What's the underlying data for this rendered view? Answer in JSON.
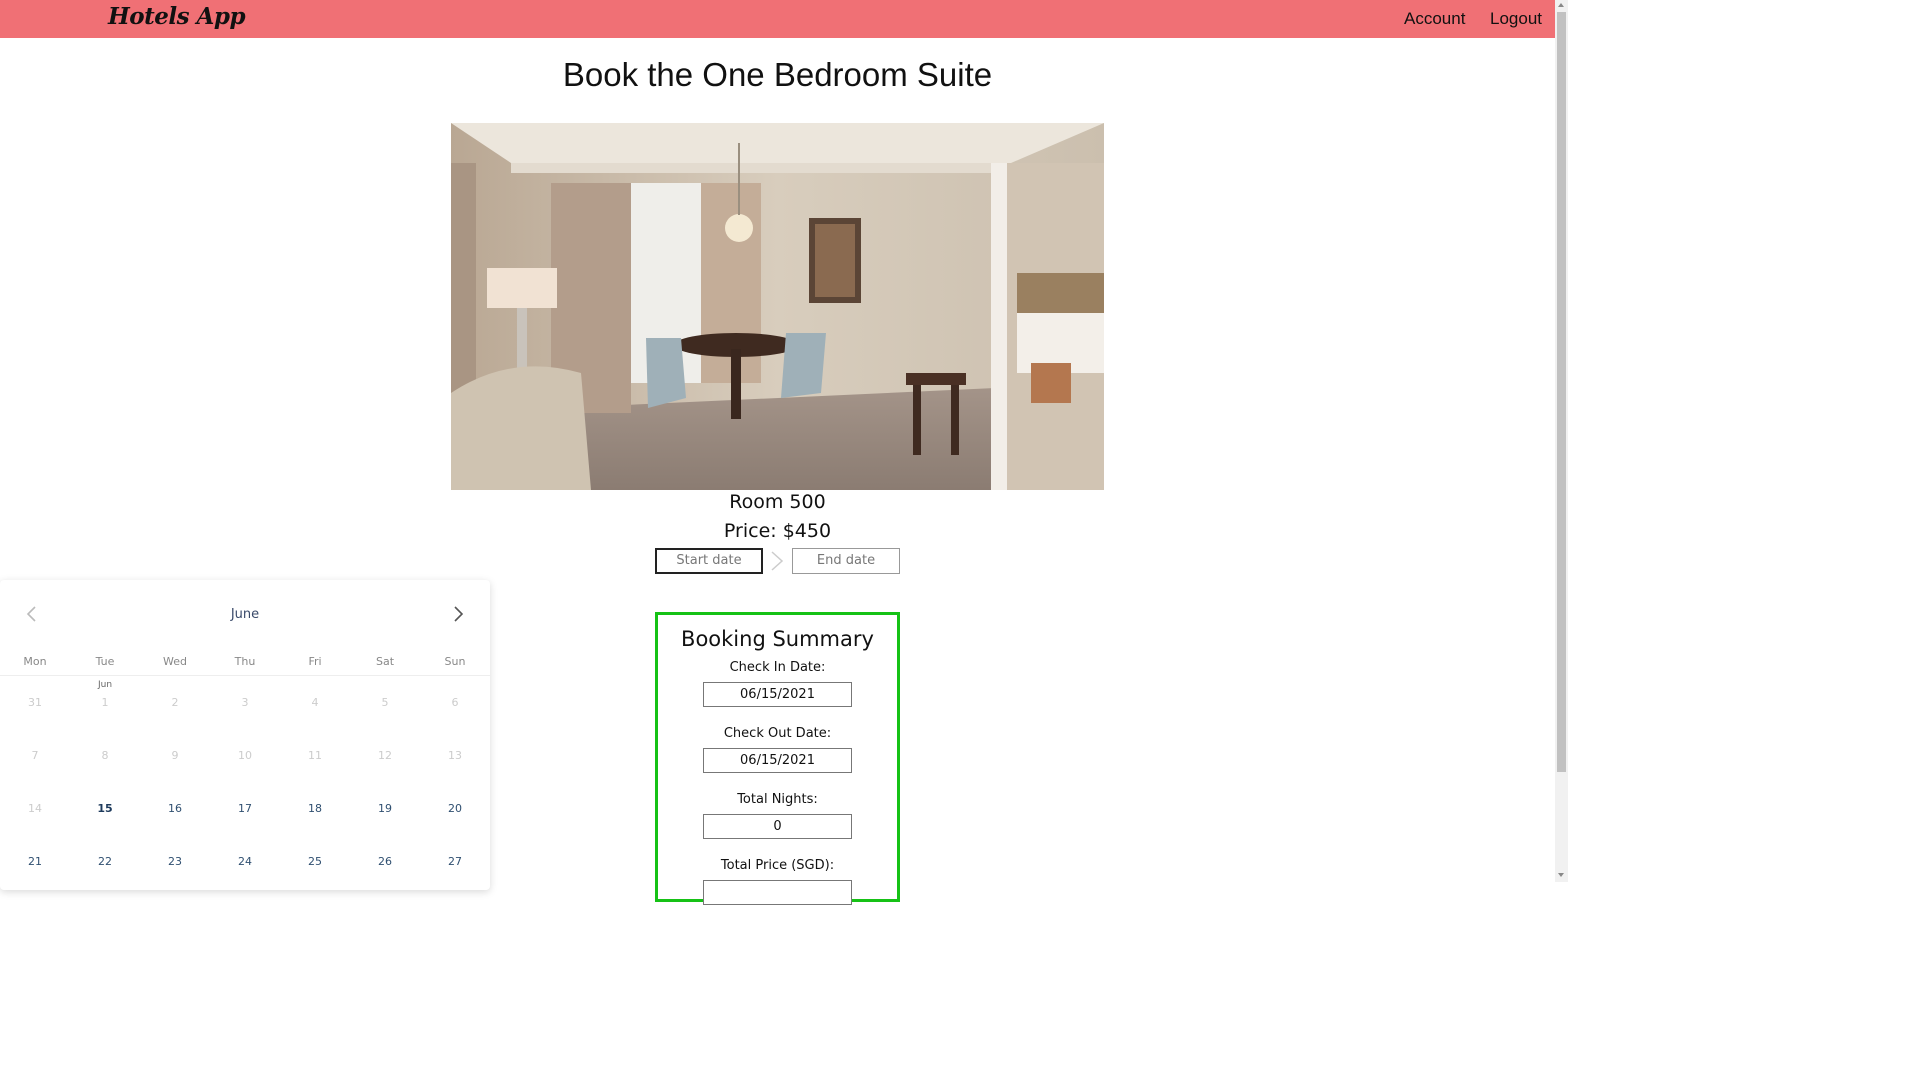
{
  "navbar": {
    "brand": "Hotels App",
    "links": [
      "Account",
      "Logout"
    ],
    "color": "#f07075"
  },
  "page": {
    "title": "Book the One Bedroom Suite"
  },
  "room": {
    "photo_icon": "room-photo",
    "number": "Room 500",
    "price": "Price: $450"
  },
  "date_range": {
    "start_placeholder": "Start date",
    "end_placeholder": "End date"
  },
  "calendar": {
    "month": "June",
    "weekdays": [
      "Mon",
      "Tue",
      "Wed",
      "Thu",
      "Fri",
      "Sat",
      "Sun"
    ],
    "month_marker": "Jun",
    "weeks": [
      [
        "31",
        "1",
        "2",
        "3",
        "4",
        "5",
        "6"
      ],
      [
        "7",
        "8",
        "9",
        "10",
        "11",
        "12",
        "13"
      ],
      [
        "14",
        "15",
        "16",
        "17",
        "18",
        "19",
        "20"
      ],
      [
        "21",
        "22",
        "23",
        "24",
        "25",
        "26",
        "27"
      ]
    ],
    "today": "15"
  },
  "summary": {
    "title": "Booking Summary",
    "check_in_label": "Check In Date:",
    "check_in_value": "06/15/2021",
    "check_out_label": "Check Out Date:",
    "check_out_value": "06/15/2021",
    "nights_label": "Total Nights:",
    "nights_value": "0",
    "price_label": "Total Price (SGD):",
    "border_color": "#16c216"
  }
}
